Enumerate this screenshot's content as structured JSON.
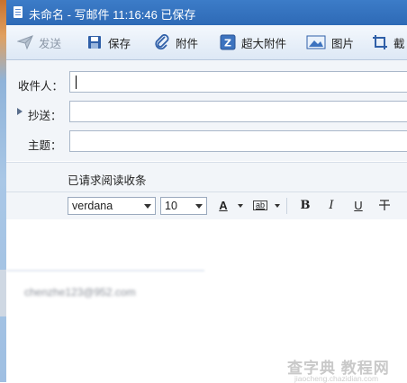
{
  "window": {
    "title": "未命名 - 写邮件   11:16:46 已保存"
  },
  "toolbar": {
    "items": [
      {
        "label": "发送",
        "icon": "send-icon",
        "enabled": false
      },
      {
        "label": "保存",
        "icon": "save-icon",
        "enabled": true
      },
      {
        "label": "附件",
        "icon": "paperclip-icon",
        "enabled": true
      },
      {
        "label": "超大附件",
        "icon": "large-attachment-icon",
        "enabled": true
      },
      {
        "label": "图片",
        "icon": "image-icon",
        "enabled": true
      },
      {
        "label": "截",
        "icon": "screenshot-icon",
        "enabled": true
      }
    ]
  },
  "form": {
    "to_label": "收件人：",
    "to_value": "",
    "cc_label": "抄送：",
    "cc_value": "",
    "subject_label": "主题：",
    "subject_value": ""
  },
  "receipt": {
    "label": "已请求阅读收条"
  },
  "format": {
    "font_family": "verdana",
    "font_size": "10",
    "font_color_label": "A",
    "highlight_label": "ab",
    "bold": "B",
    "italic": "I",
    "underline": "U",
    "strike": "干"
  },
  "editor": {
    "blurred_text": "chenzhe123@952.com"
  },
  "watermark": {
    "text": "查字典 教程网",
    "sub": "jiaocheng.chazidian.com"
  },
  "colors": {
    "titlebar": "#2e6ab6",
    "toolbar_bg": "#dde8f5",
    "form_bg": "#f2f5f9"
  }
}
